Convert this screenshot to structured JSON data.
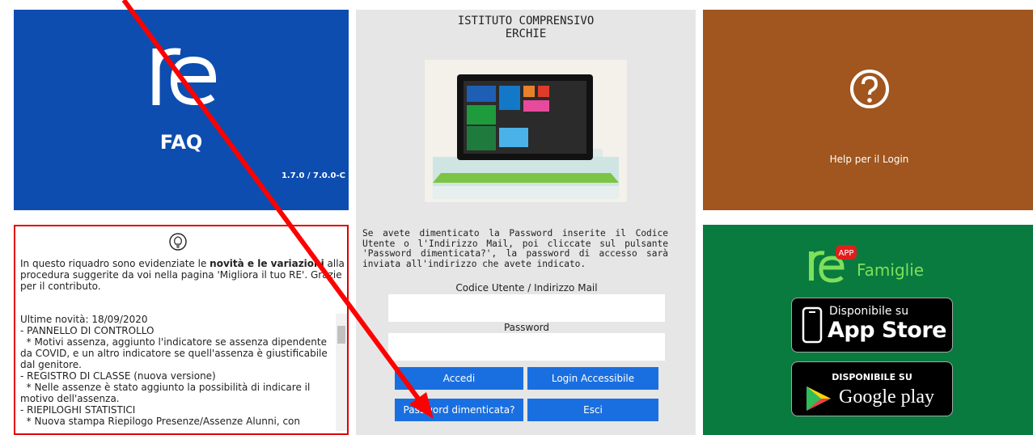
{
  "faq": {
    "label": "FAQ",
    "version": "1.7.0 / 7.0.0-C"
  },
  "school": {
    "line1": "ISTITUTO COMPRENSIVO",
    "line2": "ERCHIE"
  },
  "login": {
    "info": "Se avete dimenticato la Password inserite il Codice Utente o l'Indirizzo Mail, poi cliccate sul pulsante 'Password dimenticata?', la password di accesso sarà inviata all'indirizzo che avete indicato.",
    "user_label": "Codice Utente / Indirizzo Mail",
    "user_value": "",
    "password_label": "Password",
    "password_value": "",
    "buttons": {
      "accedi": "Accedi",
      "accessibile": "Login Accessibile",
      "dimenticata": "Password dimenticata?",
      "esci": "Esci"
    }
  },
  "help": {
    "label": "Help per il Login"
  },
  "news": {
    "intro_start": "In questo riquadro sono evidenziate le ",
    "intro_bold": "novità e le variazioni",
    "intro_end": " alla procedura suggerite da voi nella pagina 'Migliora il tuo RE'. Grazie per il contributo.",
    "changelog": "Ultime novità: 18/09/2020\n- PANNELLO DI CONTROLLO\n  * Motivi assenza, aggiunto l'indicatore se assenza dipendente da COVID, e un altro indicatore se quell'assenza è giustificabile dal genitore.\n- REGISTRO DI CLASSE (nuova versione)\n  * Nelle assenze è stato aggiunto la possibilità di indicare il motivo dell'assenza.\n- RIEPILOGHI STATISTICI\n  * Nuova stampa Riepilogo Presenze/Assenze Alunni, con"
  },
  "app": {
    "app_badge": "APP",
    "famiglie": "Famiglie",
    "appstore_small": "Disponibile su",
    "appstore_big": "App Store",
    "gplay_small": "DISPONIBILE SU",
    "gplay_big": "Google play"
  },
  "colors": {
    "faq_bg": "#0d4db0",
    "help_bg": "#a0561e",
    "app_bg": "#0a7b3e",
    "button_bg": "#1a6fe0",
    "news_border": "#e00000",
    "annotation_arrow": "#ff0000"
  }
}
